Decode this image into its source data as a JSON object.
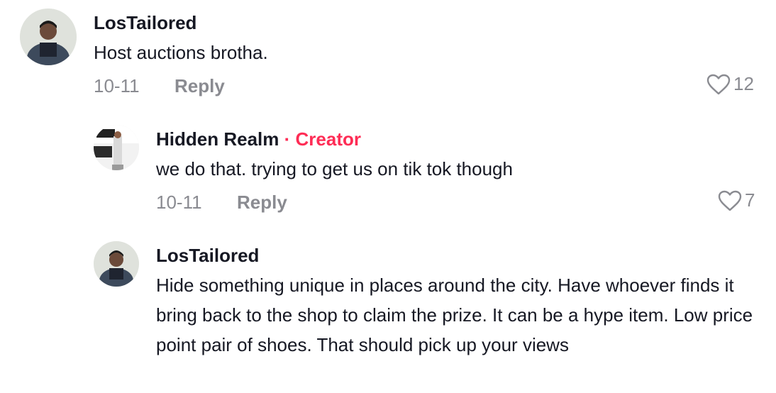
{
  "comments": [
    {
      "username": "LosTailored",
      "text": "Host auctions brotha.",
      "date": "10-11",
      "reply_label": "Reply",
      "likes": "12"
    },
    {
      "username": "Hidden Realm",
      "separator": "·",
      "creator_label": "Creator",
      "text": "we do that. trying to get us on tik tok though",
      "date": "10-11",
      "reply_label": "Reply",
      "likes": "7"
    },
    {
      "username": "LosTailored",
      "text": "Hide something unique in places around the city. Have whoever finds it bring back to the shop to claim the prize. It can be a hype item. Low price point pair of shoes. That should pick up your views"
    }
  ],
  "colors": {
    "creator": "#fe2c55",
    "meta": "#8a8b91",
    "text": "#161823"
  },
  "icons": {
    "like": "heart-outline-icon"
  }
}
